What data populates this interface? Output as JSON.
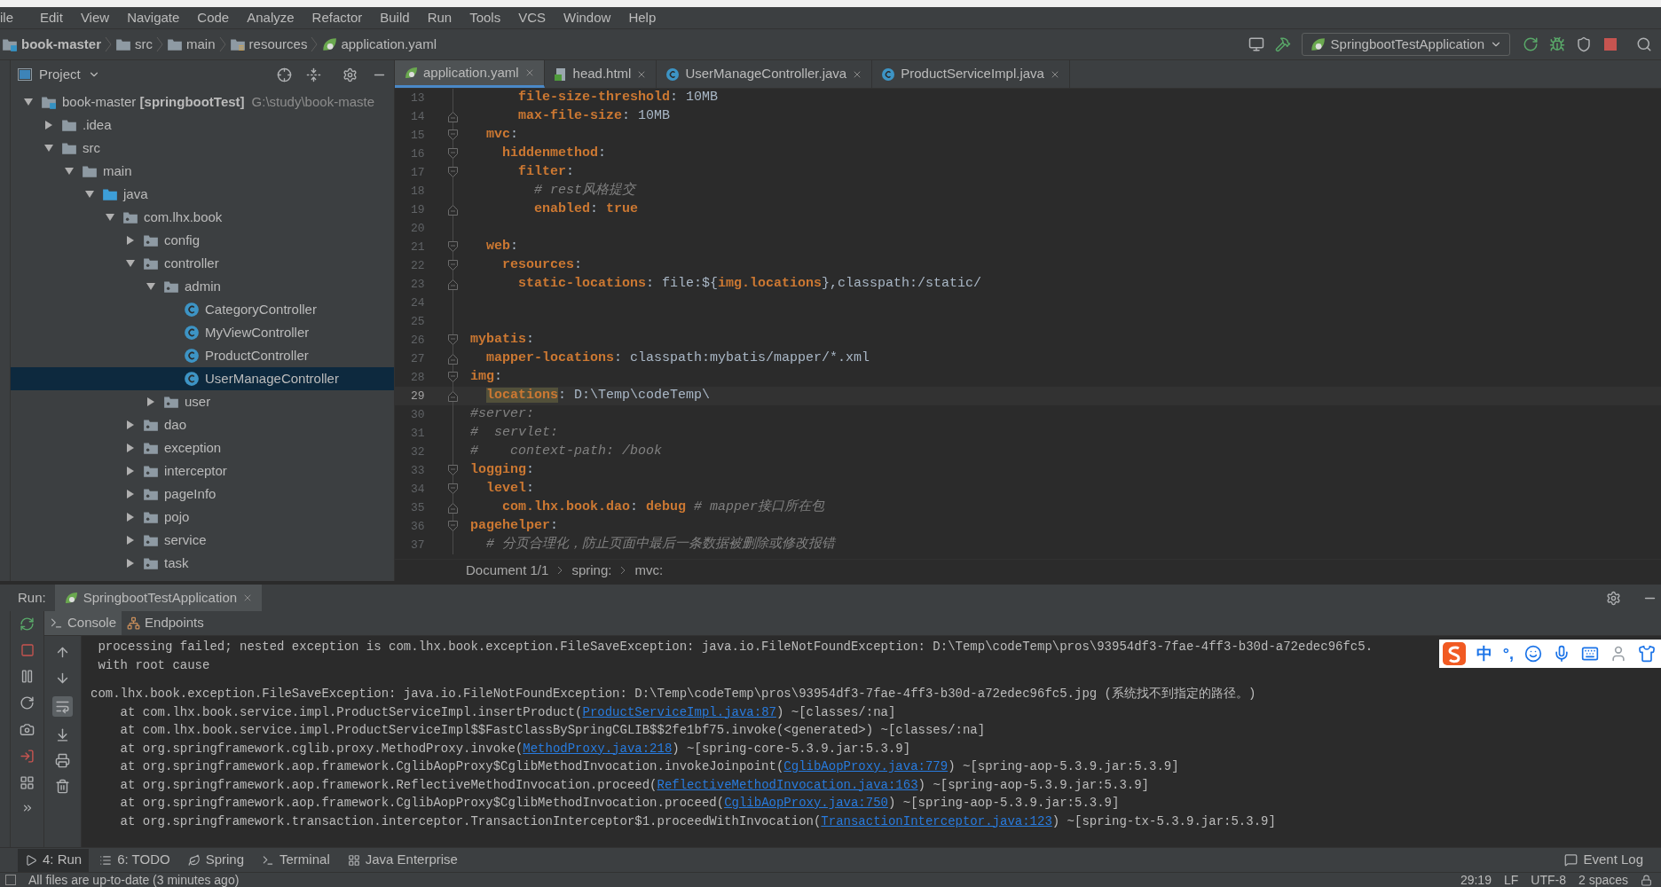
{
  "menu": [
    "ile",
    "Edit",
    "View",
    "Navigate",
    "Code",
    "Analyze",
    "Refactor",
    "Build",
    "Run",
    "Tools",
    "VCS",
    "Window",
    "Help"
  ],
  "breadcrumbs": [
    {
      "label": "book-master",
      "kind": "module"
    },
    {
      "label": "src",
      "kind": "folder"
    },
    {
      "label": "main",
      "kind": "folder"
    },
    {
      "label": "resources",
      "kind": "resources"
    },
    {
      "label": "application.yaml",
      "kind": "yaml"
    }
  ],
  "run_config": "SpringbootTestApplication",
  "project_panel": {
    "title": "Project",
    "tree": [
      {
        "kind": "module",
        "label": "book-master **[springbootTest]**",
        "path": "G:\\study\\book-maste",
        "expanded": true,
        "selected": false,
        "children": [
          {
            "kind": "folder",
            "label": ".idea",
            "expanded": false,
            "selected": false
          },
          {
            "kind": "folder",
            "label": "src",
            "expanded": true,
            "selected": false,
            "children": [
              {
                "kind": "folder",
                "label": "main",
                "expanded": true,
                "selected": false,
                "children": [
                  {
                    "kind": "source",
                    "label": "java",
                    "expanded": true,
                    "selected": false,
                    "children": [
                      {
                        "kind": "package",
                        "label": "com.lhx.book",
                        "expanded": true,
                        "selected": false,
                        "children": [
                          {
                            "kind": "package",
                            "label": "config",
                            "expanded": false,
                            "selected": false
                          },
                          {
                            "kind": "package",
                            "label": "controller",
                            "expanded": true,
                            "selected": false,
                            "children": [
                              {
                                "kind": "package",
                                "label": "admin",
                                "expanded": true,
                                "selected": false,
                                "children": [
                                  {
                                    "kind": "class",
                                    "label": "CategoryController",
                                    "selected": false
                                  },
                                  {
                                    "kind": "class",
                                    "label": "MyViewController",
                                    "selected": false
                                  },
                                  {
                                    "kind": "class",
                                    "label": "ProductController",
                                    "selected": false
                                  },
                                  {
                                    "kind": "class",
                                    "label": "UserManageController",
                                    "selected": true
                                  }
                                ]
                              },
                              {
                                "kind": "package",
                                "label": "user",
                                "expanded": false,
                                "selected": false
                              }
                            ]
                          },
                          {
                            "kind": "package",
                            "label": "dao",
                            "expanded": false,
                            "selected": false
                          },
                          {
                            "kind": "package",
                            "label": "exception",
                            "expanded": false,
                            "selected": false
                          },
                          {
                            "kind": "package",
                            "label": "interceptor",
                            "expanded": false,
                            "selected": false
                          },
                          {
                            "kind": "package",
                            "label": "pageInfo",
                            "expanded": false,
                            "selected": false
                          },
                          {
                            "kind": "package",
                            "label": "pojo",
                            "expanded": false,
                            "selected": false
                          },
                          {
                            "kind": "package",
                            "label": "service",
                            "expanded": false,
                            "selected": false
                          },
                          {
                            "kind": "package",
                            "label": "task",
                            "expanded": false,
                            "selected": false
                          }
                        ]
                      }
                    ]
                  }
                ]
              }
            ]
          }
        ]
      }
    ]
  },
  "editor_tabs": [
    {
      "label": "application.yaml",
      "kind": "yaml",
      "selected": true
    },
    {
      "label": "head.html",
      "kind": "html",
      "selected": false
    },
    {
      "label": "UserManageController.java",
      "kind": "class",
      "selected": false
    },
    {
      "label": "ProductServiceImpl.java",
      "kind": "class",
      "selected": false
    }
  ],
  "editor_lines": [
    {
      "number": "13",
      "current": false,
      "fold_open": false,
      "fold_close": false,
      "tokens": [
        {
          "kind": "key",
          "text": "      file-size-threshold"
        },
        {
          "kind": "plain",
          "text": ": 10MB"
        }
      ]
    },
    {
      "number": "14",
      "current": false,
      "fold_open": false,
      "fold_close": true,
      "tokens": [
        {
          "kind": "key",
          "text": "      max-file-size"
        },
        {
          "kind": "plain",
          "text": ": 10MB"
        }
      ]
    },
    {
      "number": "15",
      "current": false,
      "fold_open": true,
      "fold_close": false,
      "tokens": [
        {
          "kind": "key",
          "text": "  mvc"
        },
        {
          "kind": "plain",
          "text": ":"
        }
      ]
    },
    {
      "number": "16",
      "current": false,
      "fold_open": true,
      "fold_close": false,
      "tokens": [
        {
          "kind": "key",
          "text": "    hiddenmethod"
        },
        {
          "kind": "plain",
          "text": ":"
        }
      ]
    },
    {
      "number": "17",
      "current": false,
      "fold_open": true,
      "fold_close": false,
      "tokens": [
        {
          "kind": "key",
          "text": "      filter"
        },
        {
          "kind": "plain",
          "text": ":"
        }
      ]
    },
    {
      "number": "18",
      "current": false,
      "fold_open": false,
      "fold_close": false,
      "tokens": [
        {
          "kind": "comment",
          "text": "        # rest风格提交"
        }
      ]
    },
    {
      "number": "19",
      "current": false,
      "fold_open": false,
      "fold_close": true,
      "tokens": [
        {
          "kind": "key",
          "text": "        enabled"
        },
        {
          "kind": "plain",
          "text": ": "
        },
        {
          "kind": "keyword",
          "text": "true"
        }
      ]
    },
    {
      "number": "20",
      "current": false,
      "fold_open": false,
      "fold_close": false
    },
    {
      "number": "21",
      "current": false,
      "fold_open": true,
      "fold_close": false,
      "tokens": [
        {
          "kind": "key",
          "text": "  web"
        },
        {
          "kind": "plain",
          "text": ":"
        }
      ]
    },
    {
      "number": "22",
      "current": false,
      "fold_open": true,
      "fold_close": false,
      "tokens": [
        {
          "kind": "key",
          "text": "    resources"
        },
        {
          "kind": "plain",
          "text": ":"
        }
      ]
    },
    {
      "number": "23",
      "current": false,
      "fold_open": false,
      "fold_close": true,
      "tokens": [
        {
          "kind": "key",
          "text": "      static-locations"
        },
        {
          "kind": "plain",
          "text": ": file:${"
        },
        {
          "kind": "key",
          "text": "img.locations"
        },
        {
          "kind": "plain",
          "text": "},classpath:/static/"
        }
      ]
    },
    {
      "number": "24",
      "current": false,
      "fold_open": false,
      "fold_close": false
    },
    {
      "number": "25",
      "current": false,
      "fold_open": false,
      "fold_close": false
    },
    {
      "number": "26",
      "current": false,
      "fold_open": true,
      "fold_close": false,
      "tokens": [
        {
          "kind": "key",
          "text": "mybatis"
        },
        {
          "kind": "plain",
          "text": ":"
        }
      ]
    },
    {
      "number": "27",
      "current": false,
      "fold_open": false,
      "fold_close": true,
      "tokens": [
        {
          "kind": "key",
          "text": "  mapper-locations"
        },
        {
          "kind": "plain",
          "text": ": classpath:mybatis/mapper/*.xml"
        }
      ]
    },
    {
      "number": "28",
      "current": false,
      "fold_open": true,
      "fold_close": false,
      "tokens": [
        {
          "kind": "key",
          "text": "img"
        },
        {
          "kind": "plain",
          "text": ":"
        }
      ]
    },
    {
      "number": "29",
      "current": true,
      "fold_open": false,
      "fold_close": true,
      "tokens": [
        {
          "kind": "match",
          "text": "  locations"
        },
        {
          "kind": "plain",
          "text": ": D:\\Temp\\codeTemp\\"
        }
      ]
    },
    {
      "number": "30",
      "current": false,
      "fold_open": false,
      "fold_close": false,
      "tokens": [
        {
          "kind": "comment",
          "text": "#server:"
        }
      ]
    },
    {
      "number": "31",
      "current": false,
      "fold_open": false,
      "fold_close": false,
      "tokens": [
        {
          "kind": "comment",
          "text": "#  servlet:"
        }
      ]
    },
    {
      "number": "32",
      "current": false,
      "fold_open": false,
      "fold_close": false,
      "tokens": [
        {
          "kind": "comment",
          "text": "#    context-path: /book"
        }
      ]
    },
    {
      "number": "33",
      "current": false,
      "fold_open": true,
      "fold_close": false,
      "tokens": [
        {
          "kind": "key",
          "text": "logging"
        },
        {
          "kind": "plain",
          "text": ":"
        }
      ]
    },
    {
      "number": "34",
      "current": false,
      "fold_open": true,
      "fold_close": false,
      "tokens": [
        {
          "kind": "key",
          "text": "  level"
        },
        {
          "kind": "plain",
          "text": ":"
        }
      ]
    },
    {
      "number": "35",
      "current": false,
      "fold_open": false,
      "fold_close": true,
      "tokens": [
        {
          "kind": "key",
          "text": "    com.lhx.book.dao"
        },
        {
          "kind": "plain",
          "text": ": "
        },
        {
          "kind": "keyword",
          "text": "debug"
        },
        {
          "kind": "comment",
          "text": " # mapper接口所在包"
        }
      ]
    },
    {
      "number": "36",
      "current": false,
      "fold_open": true,
      "fold_close": false,
      "tokens": [
        {
          "kind": "key",
          "text": "pagehelper"
        },
        {
          "kind": "plain",
          "text": ":"
        }
      ]
    },
    {
      "number": "37",
      "current": false,
      "fold_open": false,
      "fold_close": false,
      "tokens": [
        {
          "kind": "comment",
          "text": "  # 分页合理化，防止页面中最后一条数据被删除或修改报错"
        }
      ]
    }
  ],
  "editor_breadcrumbs": [
    "Document 1/1",
    "spring:",
    "mvc:"
  ],
  "run_panel": {
    "label": "Run:",
    "tab": "SpringbootTestApplication",
    "tabs": [
      {
        "label": "Console",
        "kind": "console",
        "selected": true
      },
      {
        "label": "Endpoints",
        "kind": "endpoints",
        "selected": false
      }
    ],
    "console_lines": [
      {
        "blank_before": false,
        "tokens": [
          {
            "kind": "plain",
            "text": " processing failed; nested exception is com.lhx.book.exception.FileSaveException: java.io.FileNotFoundException: D:\\Temp\\codeTemp\\pros\\93954df3-7fae-4ff3-b30d-a72edec96fc5."
          }
        ]
      },
      {
        "blank_before": false,
        "tokens": [
          {
            "kind": "plain",
            "text": " with root cause"
          }
        ]
      },
      {
        "blank_before": true,
        "tokens": [
          {
            "kind": "plain",
            "text": "com.lhx.book.exception.FileSaveException: java.io.FileNotFoundException: D:\\Temp\\codeTemp\\pros\\93954df3-7fae-4ff3-b30d-a72edec96fc5.jpg (系统找不到指定的路径。)"
          }
        ]
      },
      {
        "blank_before": false,
        "tokens": [
          {
            "kind": "plain",
            "text": "    at com.lhx.book.service.impl.ProductServiceImpl.insertProduct("
          },
          {
            "kind": "link",
            "text": "ProductServiceImpl.java:87"
          },
          {
            "kind": "plain",
            "text": ") ~[classes/:na]"
          }
        ]
      },
      {
        "blank_before": false,
        "tokens": [
          {
            "kind": "plain",
            "text": "    at com.lhx.book.service.impl.ProductServiceImpl$$FastClassBySpringCGLIB$$2fe1bf75.invoke(<generated>) ~[classes/:na]"
          }
        ]
      },
      {
        "blank_before": false,
        "tokens": [
          {
            "kind": "plain",
            "text": "    at org.springframework.cglib.proxy.MethodProxy.invoke("
          },
          {
            "kind": "link",
            "text": "MethodProxy.java:218"
          },
          {
            "kind": "plain",
            "text": ") ~[spring-core-5.3.9.jar:5.3.9]"
          }
        ]
      },
      {
        "blank_before": false,
        "tokens": [
          {
            "kind": "plain",
            "text": "    at org.springframework.aop.framework.CglibAopProxy$CglibMethodInvocation.invokeJoinpoint("
          },
          {
            "kind": "link",
            "text": "CglibAopProxy.java:779"
          },
          {
            "kind": "plain",
            "text": ") ~[spring-aop-5.3.9.jar:5.3.9]"
          }
        ]
      },
      {
        "blank_before": false,
        "tokens": [
          {
            "kind": "plain",
            "text": "    at org.springframework.aop.framework.ReflectiveMethodInvocation.proceed("
          },
          {
            "kind": "link",
            "text": "ReflectiveMethodInvocation.java:163"
          },
          {
            "kind": "plain",
            "text": ") ~[spring-aop-5.3.9.jar:5.3.9]"
          }
        ]
      },
      {
        "blank_before": false,
        "tokens": [
          {
            "kind": "plain",
            "text": "    at org.springframework.aop.framework.CglibAopProxy$CglibMethodInvocation.proceed("
          },
          {
            "kind": "link",
            "text": "CglibAopProxy.java:750"
          },
          {
            "kind": "plain",
            "text": ") ~[spring-aop-5.3.9.jar:5.3.9]"
          }
        ]
      },
      {
        "blank_before": false,
        "tokens": [
          {
            "kind": "plain",
            "text": "    at org.springframework.transaction.interceptor.TransactionInterceptor$1.proceedWithInvocation("
          },
          {
            "kind": "link",
            "text": "TransactionInterceptor.java:123"
          },
          {
            "kind": "plain",
            "text": ") ~[spring-tx-5.3.9.jar:5.3.9]"
          }
        ]
      }
    ]
  },
  "ime_toolbar": [
    "中",
    "°,"
  ],
  "tool_buttons": [
    {
      "label": "4: Run",
      "kind": "run",
      "selected": true
    },
    {
      "label": "6: TODO",
      "kind": "todo",
      "selected": false
    },
    {
      "label": "Spring",
      "kind": "spring",
      "selected": false
    },
    {
      "label": "Terminal",
      "kind": "terminal",
      "selected": false
    },
    {
      "label": "Java Enterprise",
      "kind": "enterprise",
      "selected": false
    }
  ],
  "event_log": "Event Log",
  "status_bar": {
    "message": "All files are up-to-date (3 minutes ago)",
    "position": "29:19",
    "line_separator": "LF",
    "encoding": "UTF-8",
    "indent": "2 spaces"
  }
}
